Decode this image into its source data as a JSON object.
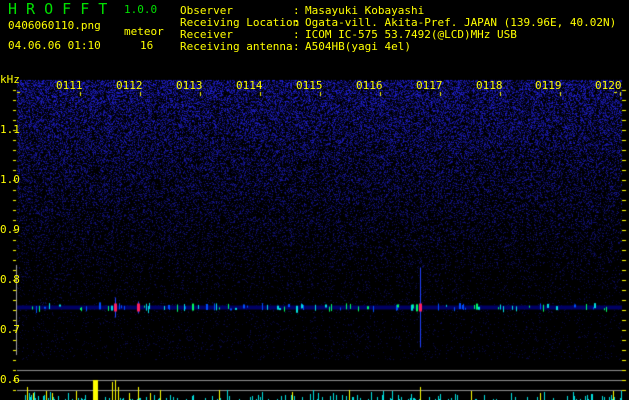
{
  "header": {
    "app_name": "H R O F F T",
    "version": "1.0.0",
    "filename": "0406060110.png",
    "datetime": "04.06.06 01:10",
    "meteor_label": "meteor",
    "meteor_count": "16"
  },
  "info": [
    {
      "label": "Observer",
      "value": "Masayuki Kobayashi"
    },
    {
      "label": "Receiving Location",
      "value": "Ogata-vill. Akita-Pref. JAPAN (139.96E, 40.02N)"
    },
    {
      "label": "Receiver",
      "value": "ICOM IC-575 53.7492(@LCD)MHz USB"
    },
    {
      "label": "Receiving antenna",
      "value": "A504HB(yagi 4el)"
    }
  ],
  "spectrogram": {
    "unit_label": "kHz",
    "freq_ticks": [
      "1.1",
      "1.0",
      "0.9",
      "0.8",
      "0.7",
      "0.6"
    ],
    "time_labels": [
      "0111",
      "0112",
      "0113",
      "0114",
      "0115",
      "0116",
      "0117",
      "0118",
      "0119",
      "0120"
    ],
    "echo_frequency_khz": 0.745,
    "colors": {
      "text": "#ffff00",
      "title": "#00e000",
      "noise": "#2020c0",
      "histogram": "#00e0e0",
      "meteor": "#ffff00"
    }
  }
}
